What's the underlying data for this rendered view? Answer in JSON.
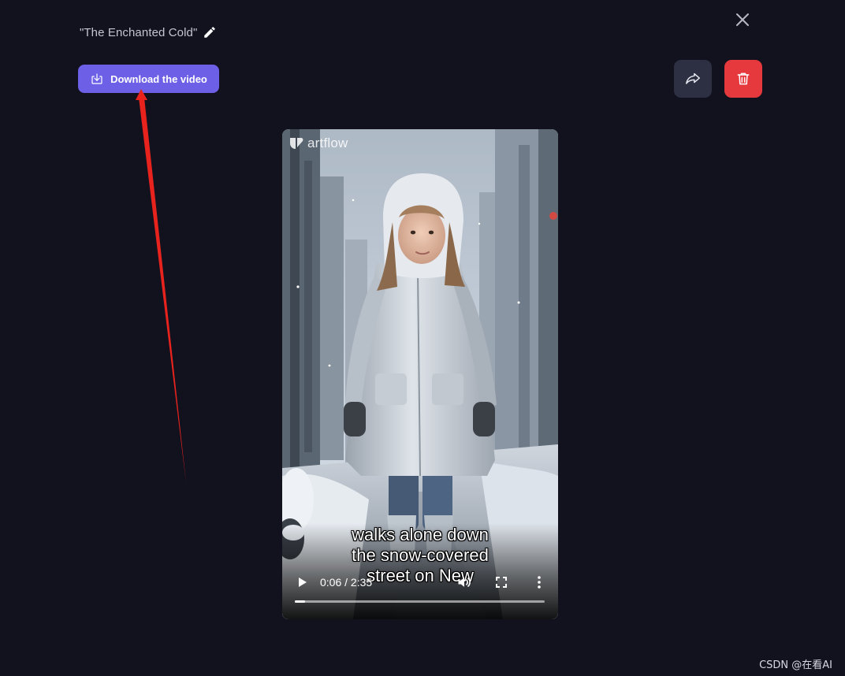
{
  "header": {
    "title": "\"The Enchanted Cold\"",
    "edit_icon": "pencil-icon",
    "close_icon": "close-icon"
  },
  "actions": {
    "download_label": "Download the video",
    "download_icon": "download-icon",
    "share_icon": "share-arrow-icon",
    "delete_icon": "trash-icon"
  },
  "video": {
    "logo_text": "artflow",
    "caption_lines": [
      "walks alone down",
      "the snow-covered",
      "street on New"
    ],
    "time_display": "0:06 / 2:35",
    "progress_fraction": 0.04
  },
  "watermark": "CSDN @在看AI",
  "colors": {
    "background": "#12121f",
    "primary": "#6d5fe6",
    "danger": "#e5393e",
    "secondary": "#2c3042",
    "annotation_arrow": "#e8231d"
  }
}
